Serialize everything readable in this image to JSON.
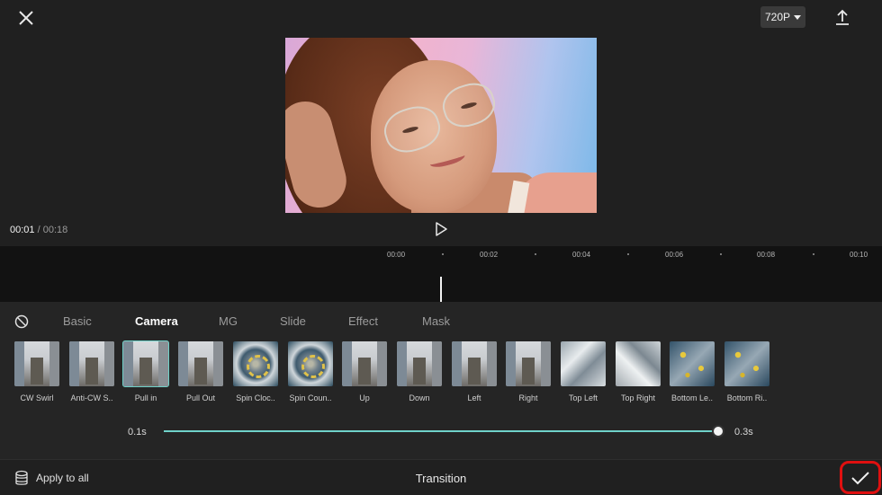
{
  "header": {
    "resolution_label": "720P",
    "close_icon": "close-icon",
    "export_icon": "export-icon"
  },
  "player": {
    "current_time": "00:01",
    "separator": " / ",
    "total_time": "00:18"
  },
  "timeline": {
    "ticks": [
      "00:00",
      "00:02",
      "00:04",
      "00:06",
      "00:08",
      "00:10"
    ]
  },
  "panel": {
    "tabs": [
      {
        "label": "Basic",
        "active": false
      },
      {
        "label": "Camera",
        "active": true
      },
      {
        "label": "MG",
        "active": false
      },
      {
        "label": "Slide",
        "active": false
      },
      {
        "label": "Effect",
        "active": false
      },
      {
        "label": "Mask",
        "active": false
      }
    ],
    "transitions": [
      {
        "label": "CW Swirl",
        "style": "city"
      },
      {
        "label": "Anti-CW S..",
        "style": "city"
      },
      {
        "label": "Pull in",
        "style": "city",
        "selected": true
      },
      {
        "label": "Pull Out",
        "style": "city"
      },
      {
        "label": "Spin Cloc..",
        "style": "swirl"
      },
      {
        "label": "Spin Coun..",
        "style": "swirl"
      },
      {
        "label": "Up",
        "style": "city"
      },
      {
        "label": "Down",
        "style": "city"
      },
      {
        "label": "Left",
        "style": "city"
      },
      {
        "label": "Right",
        "style": "city"
      },
      {
        "label": "Top Left",
        "style": "blur"
      },
      {
        "label": "Top Right",
        "style": "blur2"
      },
      {
        "label": "Bottom Le..",
        "style": "spots"
      },
      {
        "label": "Bottom Ri..",
        "style": "spots"
      }
    ],
    "duration": {
      "min_label": "0.1s",
      "max_label": "0.3s",
      "value_fraction": 1.0
    }
  },
  "footer": {
    "apply_label": "Apply to all",
    "title": "Transition"
  },
  "colors": {
    "accent": "#6fd2c9",
    "highlight_ring": "#e01010"
  }
}
